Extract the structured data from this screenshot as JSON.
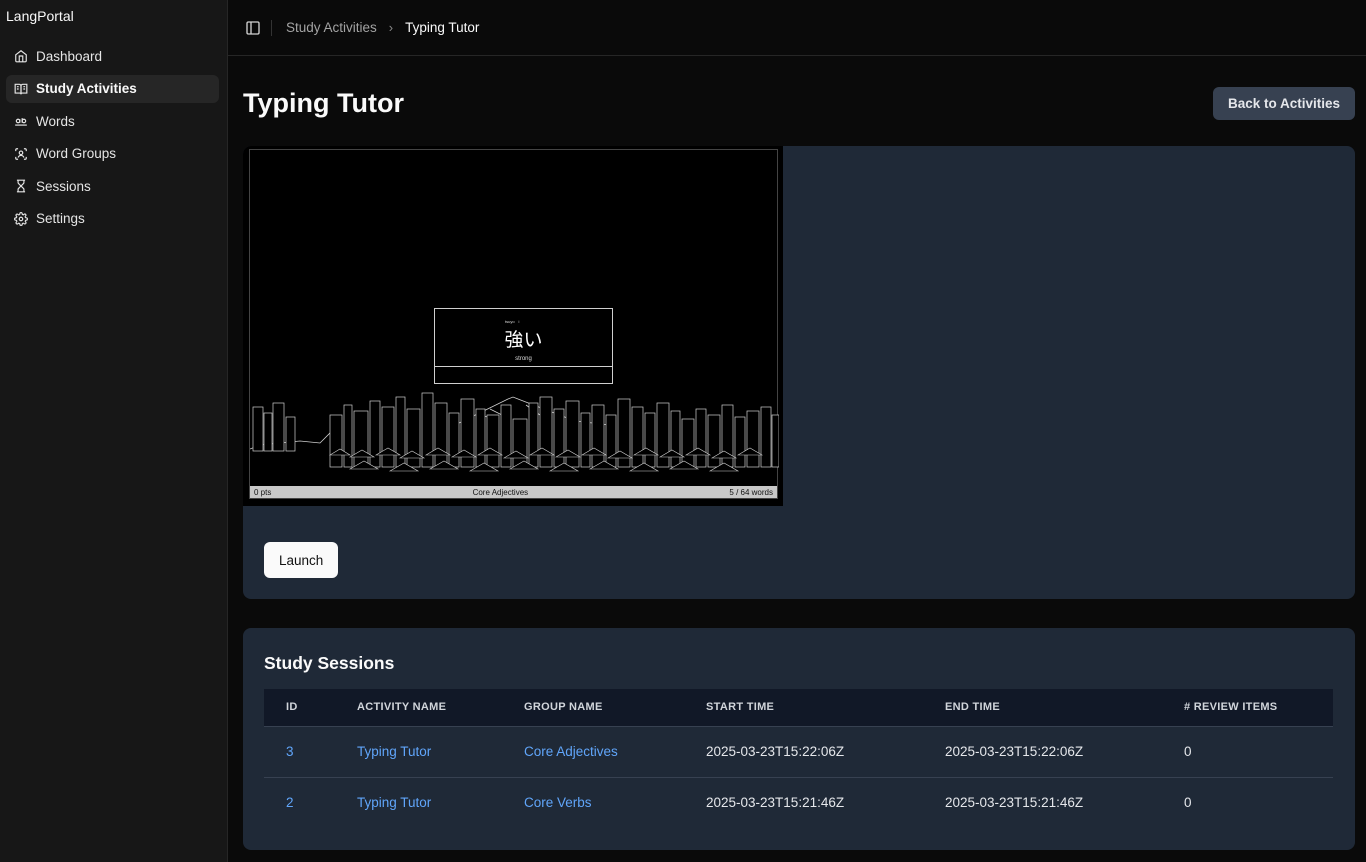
{
  "app": {
    "brand": "LangPortal"
  },
  "sidebar": {
    "items": [
      {
        "label": "Dashboard",
        "icon": "home-icon",
        "active": false
      },
      {
        "label": "Study Activities",
        "icon": "book-open-icon",
        "active": true
      },
      {
        "label": "Words",
        "icon": "whole-word-icon",
        "active": false
      },
      {
        "label": "Word Groups",
        "icon": "group-icon",
        "active": false
      },
      {
        "label": "Sessions",
        "icon": "hourglass-icon",
        "active": false
      },
      {
        "label": "Settings",
        "icon": "gear-icon",
        "active": false
      }
    ]
  },
  "breadcrumb": {
    "parent": "Study Activities",
    "current": "Typing Tutor"
  },
  "page": {
    "title": "Typing Tutor",
    "back_label": "Back to Activities"
  },
  "preview": {
    "reading": "tsuyo　i",
    "kanji": "強い",
    "meaning": "strong",
    "points": "0 pts",
    "group": "Core Adjectives",
    "progress": "5 / 64 words"
  },
  "launch_label": "Launch",
  "sessions": {
    "title": "Study Sessions",
    "columns": [
      "ID",
      "ACTIVITY NAME",
      "GROUP NAME",
      "START TIME",
      "END TIME",
      "# REVIEW ITEMS"
    ],
    "rows": [
      {
        "id": "3",
        "activity": "Typing Tutor",
        "group": "Core Adjectives",
        "start": "2025-03-23T15:22:06Z",
        "end": "2025-03-23T15:22:06Z",
        "review_items": "0"
      },
      {
        "id": "2",
        "activity": "Typing Tutor",
        "group": "Core Verbs",
        "start": "2025-03-23T15:21:46Z",
        "end": "2025-03-23T15:21:46Z",
        "review_items": "0"
      }
    ]
  },
  "colors": {
    "link": "#60a5fa",
    "card": "#1f2937",
    "background": "#0a0a0a"
  }
}
